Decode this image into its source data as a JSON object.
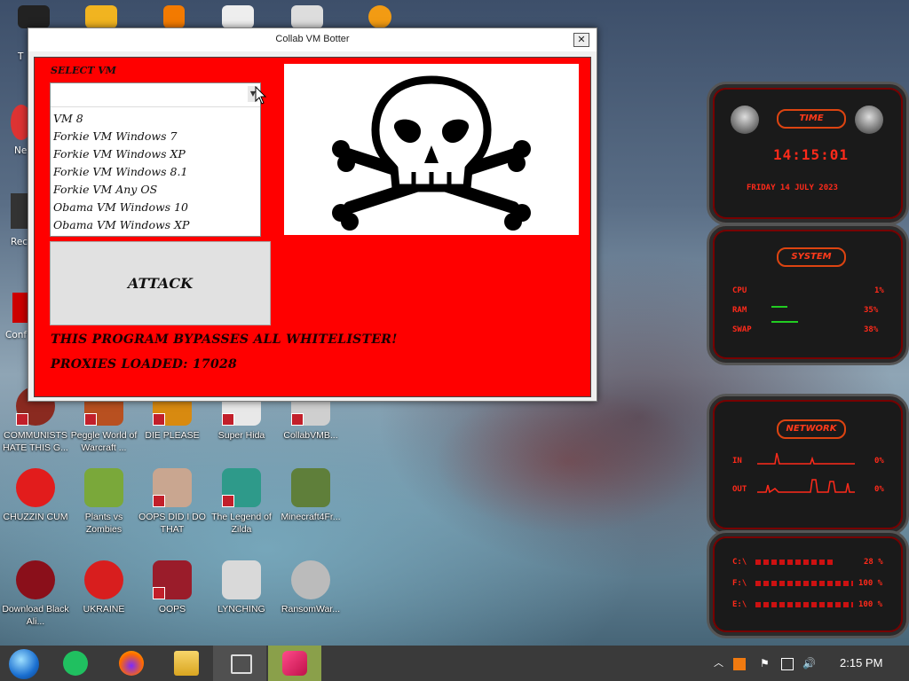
{
  "window": {
    "title": "Collab VM Botter",
    "close_glyph": "✕",
    "select_label": "SELECT VM",
    "vm_options": [
      "VM 8",
      "Forkie VM Windows 7",
      "Forkie VM Windows XP",
      "Forkie VM Windows 8.1",
      "Forkie VM Any OS",
      "Obama VM Windows 10",
      "Obama VM Windows XP"
    ],
    "attack_label": "ATTACK",
    "bypass_text": "THIS PROGRAM BYPASSES ALL WHITELISTER!",
    "proxies_text": "PROXIES LOADED: 17028",
    "image_icon": "skull-crossbones-icon",
    "accent_color": "#ff0000"
  },
  "desktop_icons": [
    {
      "label": "COMMUNISTS HATE THIS G...",
      "icon": "communist-icon"
    },
    {
      "label": "Peggle World of Warcraft ...",
      "icon": "peggle-icon"
    },
    {
      "label": "DIE PLEASE",
      "icon": "die-icon"
    },
    {
      "label": "Super Hida",
      "icon": "pixel-icon"
    },
    {
      "label": "CollabVMB...",
      "icon": "collab-icon"
    },
    {
      "label": "CHUZZIN CUM",
      "icon": "chuzzle-icon"
    },
    {
      "label": "Plants vs Zombies",
      "icon": "pvz-icon"
    },
    {
      "label": "OOPS DID I DO THAT",
      "icon": "portrait-icon"
    },
    {
      "label": "The Legend of Zilda",
      "icon": "zelda-icon"
    },
    {
      "label": "Minecraft4Fr...",
      "icon": "minecraft-icon"
    },
    {
      "label": "Download Black Ali...",
      "icon": "alienware-icon"
    },
    {
      "label": "UKRAINE",
      "icon": "radiation-icon"
    },
    {
      "label": "OOPS",
      "icon": "monitor-icon"
    },
    {
      "label": "LYNCHING",
      "icon": "noose-icon"
    },
    {
      "label": "RansomWar...",
      "icon": "skull-icon"
    }
  ],
  "left_edge_labels": [
    "T",
    "Ne",
    "Rec",
    "Conf"
  ],
  "widgets": {
    "time": {
      "title": "TIME",
      "clock": "14:15:01",
      "date": "FRIDAY 14 JULY 2023"
    },
    "system": {
      "title": "SYSTEM",
      "rows": [
        {
          "name": "CPU",
          "value": "1%"
        },
        {
          "name": "RAM",
          "value": "35%"
        },
        {
          "name": "SWAP",
          "value": "38%"
        }
      ]
    },
    "network": {
      "title": "NETWORK",
      "rows": [
        {
          "name": "IN",
          "value": "0%"
        },
        {
          "name": "OUT",
          "value": "0%"
        }
      ]
    },
    "drives": {
      "rows": [
        {
          "name": "C:\\",
          "value": "28 %"
        },
        {
          "name": "F:\\",
          "value": "100 %"
        },
        {
          "name": "E:\\",
          "value": "100 %"
        }
      ]
    }
  },
  "taskbar": {
    "clock": "2:15 PM",
    "apps": [
      "start-orb-icon",
      "notes-icon",
      "firefox-icon",
      "file-explorer-icon",
      "task-view-icon",
      "collab-botter-icon"
    ],
    "tray_icons": [
      "chevron-up-icon",
      "update-icon",
      "network-flag-icon",
      "network-icon",
      "volume-icon"
    ]
  }
}
